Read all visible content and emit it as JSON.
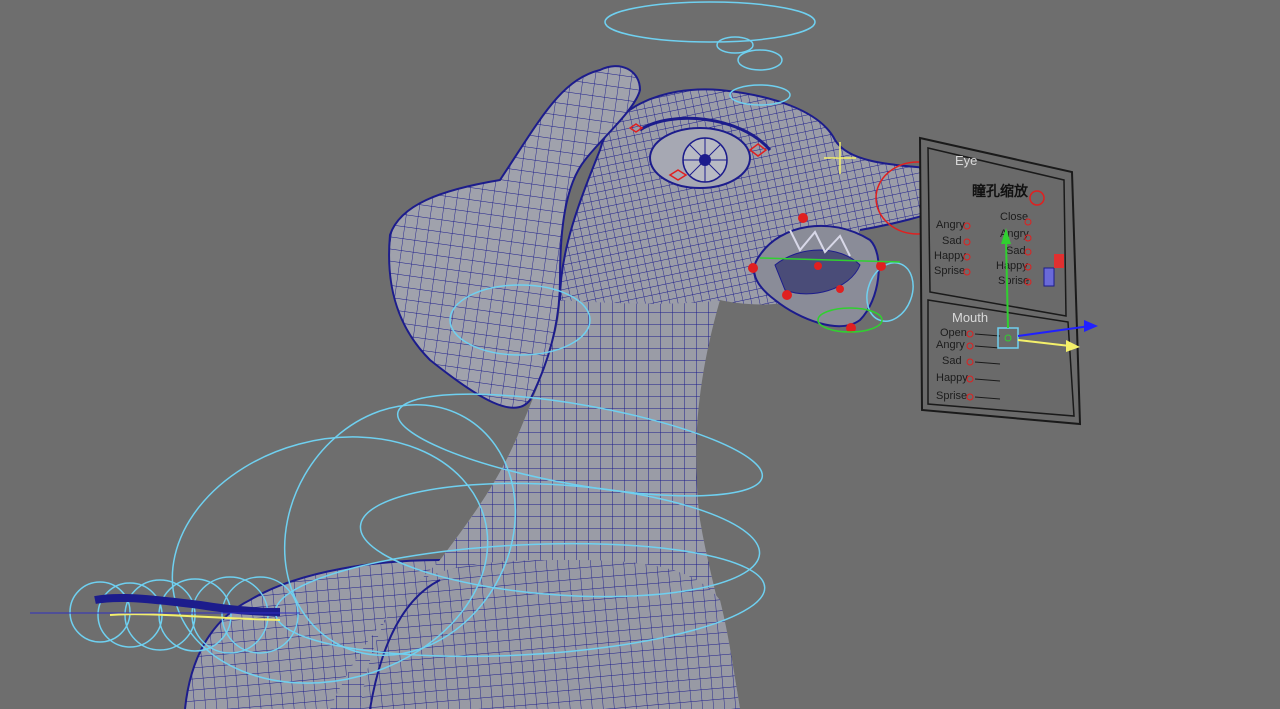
{
  "viewport": {
    "background": "#6e6e6e",
    "wire_color": "#1c1c8c",
    "surface_color": "#9a9ca6",
    "control_curve_color": "#6fd0f0",
    "locator_color": "#e02020"
  },
  "facial_panel": {
    "eye_section": {
      "header": "Eye",
      "pupil_label": "瞳孔缩放",
      "left_column": [
        "Angry",
        "Sad",
        "Happy",
        "Sprise"
      ],
      "right_column": [
        "Close",
        "Angry",
        "Sad",
        "Happy",
        "Sprise"
      ]
    },
    "mouth_section": {
      "header": "Mouth",
      "items": [
        "Open",
        "Angry",
        "Sad",
        "Happy",
        "Sprise"
      ]
    }
  },
  "icons": {
    "transform_manipulator": "move-manipulator-icon",
    "pivot": "pivot-cross-icon"
  }
}
